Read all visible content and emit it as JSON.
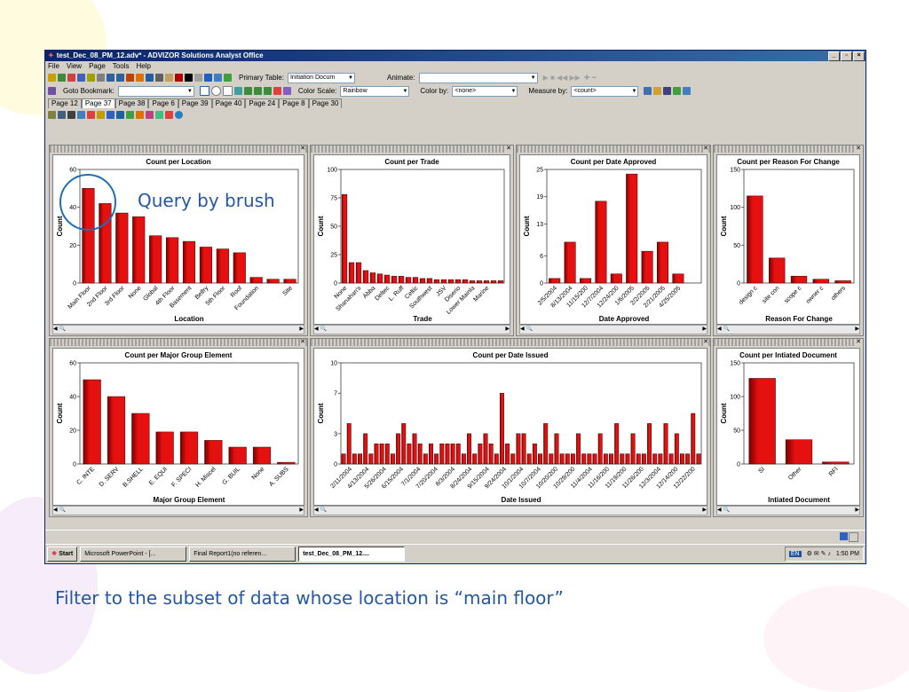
{
  "window": {
    "title": "test_Dec_08_PM_12.adv* - ADVIZOR Solutions Analyst Office",
    "controls": [
      "_",
      "▫",
      "×"
    ]
  },
  "menu": [
    "File",
    "View",
    "Page",
    "Tools",
    "Help"
  ],
  "toolbar": {
    "primary_table_label": "Primary Table:",
    "primary_table_value": "Initiation Docum",
    "animate_label": "Animate:",
    "animate_value": "",
    "goto_label": "Goto Bookmark:",
    "goto_value": "",
    "color_scale_label": "Color Scale:",
    "color_scale_value": "Rainbow",
    "color_by_label": "Color by:",
    "color_by_value": "<none>",
    "measure_by_label": "Measure by:",
    "measure_by_value": "<count>"
  },
  "tabs": [
    "Page 12",
    "Page 37",
    "Page 38",
    "Page 6",
    "Page 39",
    "Page 40",
    "Page 24",
    "Page 8",
    "Page 30"
  ],
  "active_tab": "Page 37",
  "colors": {
    "bar": "#e51010",
    "bar_dark": "#7a0000",
    "accent": "#2457a6",
    "title_start": "#0a246a",
    "title_end": "#3a6ea5"
  },
  "chart_data": [
    {
      "type": "bar",
      "title": "Count per Location",
      "xlabel": "Location",
      "ylabel": "Count",
      "ylim": [
        0,
        60
      ],
      "yticks": [
        0,
        20,
        40,
        60
      ],
      "categories": [
        "Main Floor",
        "2nd Floor",
        "3rd Floor",
        "None",
        "Global",
        "4th Floor",
        "Basement",
        "Belfry",
        "5th Floor",
        "Roof",
        "Foundation",
        "",
        "Site"
      ],
      "values": [
        50,
        42,
        37,
        35,
        25,
        24,
        22,
        19,
        18,
        16,
        3,
        2,
        2
      ]
    },
    {
      "type": "bar",
      "title": "Count per Trade",
      "xlabel": "Trade",
      "ylabel": "Count",
      "ylim": [
        0,
        100
      ],
      "yticks": [
        0,
        25,
        50,
        75,
        100
      ],
      "categories": [
        "None",
        "",
        "Shanahan's",
        "",
        "Abba",
        "",
        "Deltec",
        "",
        "L. Ruff",
        "",
        "Celtic",
        "",
        "Southwest",
        "",
        "JSV",
        "",
        "Diserio",
        "",
        "Lower Mainla",
        "",
        "Marine",
        "",
        ""
      ],
      "values": [
        78,
        18,
        18,
        11,
        9,
        8,
        7,
        6,
        6,
        5,
        5,
        4,
        4,
        3,
        3,
        3,
        3,
        3,
        2,
        2,
        2,
        2,
        2
      ]
    },
    {
      "type": "bar",
      "title": "Count per Date Approved",
      "xlabel": "Date Approved",
      "ylabel": "Count",
      "ylim": [
        0,
        25
      ],
      "yticks": [
        0,
        6,
        13,
        19,
        25
      ],
      "categories": [
        "2/5/2004",
        "8/13/2004",
        "11/15/200",
        "12/7/2004",
        "12/24/200",
        "1/6/2005",
        "2/2/2005",
        "2/21/2005",
        "4/25/2005",
        ""
      ],
      "values": [
        1,
        9,
        1,
        18,
        2,
        24,
        7,
        9,
        2,
        0
      ]
    },
    {
      "type": "bar",
      "title": "Count per Reason For Change",
      "xlabel": "Reason For Change",
      "ylabel": "Count",
      "ylim": [
        0,
        150
      ],
      "yticks": [
        0,
        50,
        100,
        150
      ],
      "categories": [
        "design c",
        "site con",
        "scope c",
        "owner c",
        "others"
      ],
      "values": [
        115,
        33,
        9,
        5,
        3
      ]
    },
    {
      "type": "bar",
      "title": "Count per Major Group Element",
      "xlabel": "Major Group Element",
      "ylabel": "Count",
      "ylim": [
        0,
        60
      ],
      "yticks": [
        0,
        20,
        40,
        60
      ],
      "categories": [
        "C. INTE",
        "D. SERV",
        "B.SHELL",
        "E. EQUI",
        "F. SPECI",
        "H. Miscel",
        "G. BUIL",
        "None",
        "A. SUBS"
      ],
      "values": [
        50,
        40,
        30,
        19,
        19,
        14,
        10,
        10,
        1
      ]
    },
    {
      "type": "bar",
      "title": "Count per  Date  Issued",
      "xlabel": "Date  Issued",
      "ylabel": "Count",
      "ylim": [
        0,
        10
      ],
      "yticks": [
        0,
        3,
        7,
        10
      ],
      "categories": [
        "2/11/2004",
        "4/13/2004",
        "5/26/2004",
        "6/15/2004",
        "7/1/2004",
        "7/20/2004",
        "8/3/2004",
        "8/24/2004",
        "9/15/2004",
        "9/24/2004",
        "10/1/2004",
        "10/7/2004",
        "10/20/200",
        "10/29/200",
        "11/4/2004",
        "11/16/200",
        "11/19/200",
        "11/26/200",
        "12/3/2004",
        "12/14/200",
        "12/22/200"
      ],
      "values": [
        1,
        4,
        1,
        1,
        3,
        1,
        2,
        2,
        2,
        1,
        3,
        4,
        2,
        3,
        2,
        1,
        2,
        1,
        2,
        2,
        2,
        2,
        1,
        3,
        1,
        2,
        3,
        2,
        1,
        7,
        2,
        1,
        3,
        3,
        1,
        2,
        1,
        4,
        1,
        3,
        1,
        1,
        1,
        3,
        1,
        1,
        1,
        3,
        1,
        1,
        4,
        1,
        1,
        3,
        1,
        1,
        4,
        1,
        1,
        4,
        1,
        3,
        1,
        1,
        5,
        1
      ]
    },
    {
      "type": "bar",
      "title": "Count per Intiated Document",
      "xlabel": "Intiated Document",
      "ylabel": "Count",
      "ylim": [
        0,
        150
      ],
      "yticks": [
        0,
        50,
        100,
        150
      ],
      "categories": [
        "SI",
        "Other",
        "RFI"
      ],
      "values": [
        127,
        36,
        3
      ]
    }
  ],
  "taskbar": {
    "start_label": "Start",
    "buttons": [
      "Microsoft PowerPoint - [...",
      "Final Report1(no referen...",
      "test_Dec_08_PM_12...."
    ],
    "lang": "EN",
    "clock": "1:50 PM"
  },
  "annotation": "Query by brush",
  "caption": "Filter to the subset of data whose location is “main floor”"
}
